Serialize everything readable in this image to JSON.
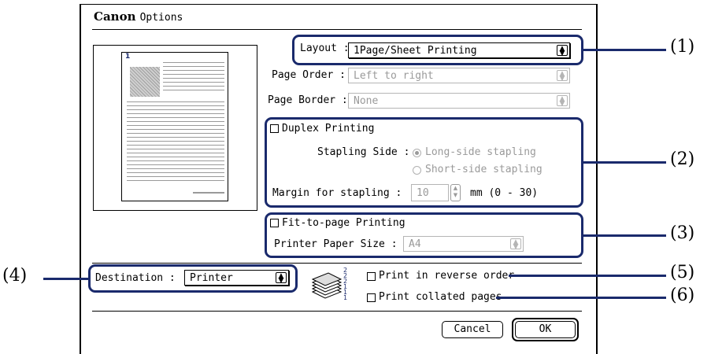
{
  "window": {
    "brand": "Canon",
    "title": "Options"
  },
  "layout": {
    "label": "Layout :",
    "value": "1Page/Sheet Printing"
  },
  "page_order": {
    "label": "Page Order :",
    "value": "Left to right"
  },
  "page_border": {
    "label": "Page Border :",
    "value": "None"
  },
  "preview": {
    "page_number": "1"
  },
  "duplex": {
    "label": "Duplex Printing",
    "stapling_side_label": "Stapling Side :",
    "options": [
      "Long-side stapling",
      "Short-side stapling"
    ],
    "margin_label": "Margin for stapling :",
    "margin_value": "10",
    "margin_unit": "mm (0 - 30)"
  },
  "fit_to_page": {
    "label": "Fit-to-page Printing",
    "paper_size_label": "Printer Paper Size :",
    "paper_size_value": "A4"
  },
  "destination": {
    "label": "Destination :",
    "value": "Printer"
  },
  "output": {
    "reverse_label": "Print in reverse order",
    "collated_label": "Print collated pages",
    "stack_numbers": "2 2 2 1 1 1"
  },
  "buttons": {
    "cancel": "Cancel",
    "ok": "OK"
  },
  "callouts": {
    "c1": "(1)",
    "c2": "(2)",
    "c3": "(3)",
    "c4": "(4)",
    "c5": "(5)",
    "c6": "(6)"
  },
  "colors": {
    "callout": "#1a2a6c",
    "disabled_text": "#9a9a9a"
  }
}
